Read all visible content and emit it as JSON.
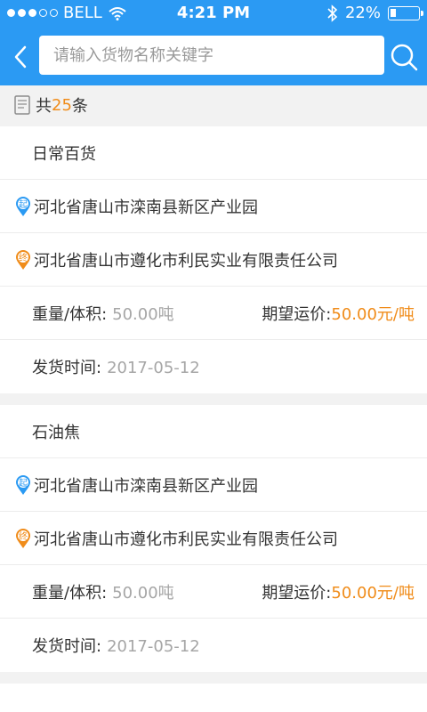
{
  "status_bar": {
    "carrier": "BELL",
    "time": "4:21 PM",
    "battery": "22%",
    "battery_level": 0.22,
    "signal_bars_on": 3,
    "signal_bars_total": 5
  },
  "header": {
    "search_placeholder": "请输入货物名称关键字"
  },
  "summary": {
    "prefix": "共",
    "count": "25",
    "suffix": "条"
  },
  "listings": [
    {
      "name": "日常百货",
      "origin": "河北省唐山市滦南县新区产业园",
      "destination": "河北省唐山市遵化市利民实业有限责任公司",
      "weight_label": "重量/体积:",
      "weight_value": "50.00吨",
      "price_label": "期望运价:",
      "price_value": "50.00元/吨",
      "date_label": "发货时间:",
      "date_value": "2017-05-12",
      "origin_badge": "起",
      "dest_badge": "终"
    },
    {
      "name": "石油焦",
      "origin": "河北省唐山市滦南县新区产业园",
      "destination": "河北省唐山市遵化市利民实业有限责任公司",
      "weight_label": "重量/体积:",
      "weight_value": "50.00吨",
      "price_label": "期望运价:",
      "price_value": "50.00元/吨",
      "date_label": "发货时间:",
      "date_value": "2017-05-12",
      "origin_badge": "起",
      "dest_badge": "终"
    }
  ],
  "colors": {
    "accent": "#2b9af3",
    "highlight": "#f08c1a",
    "muted": "#a6a6a6"
  }
}
